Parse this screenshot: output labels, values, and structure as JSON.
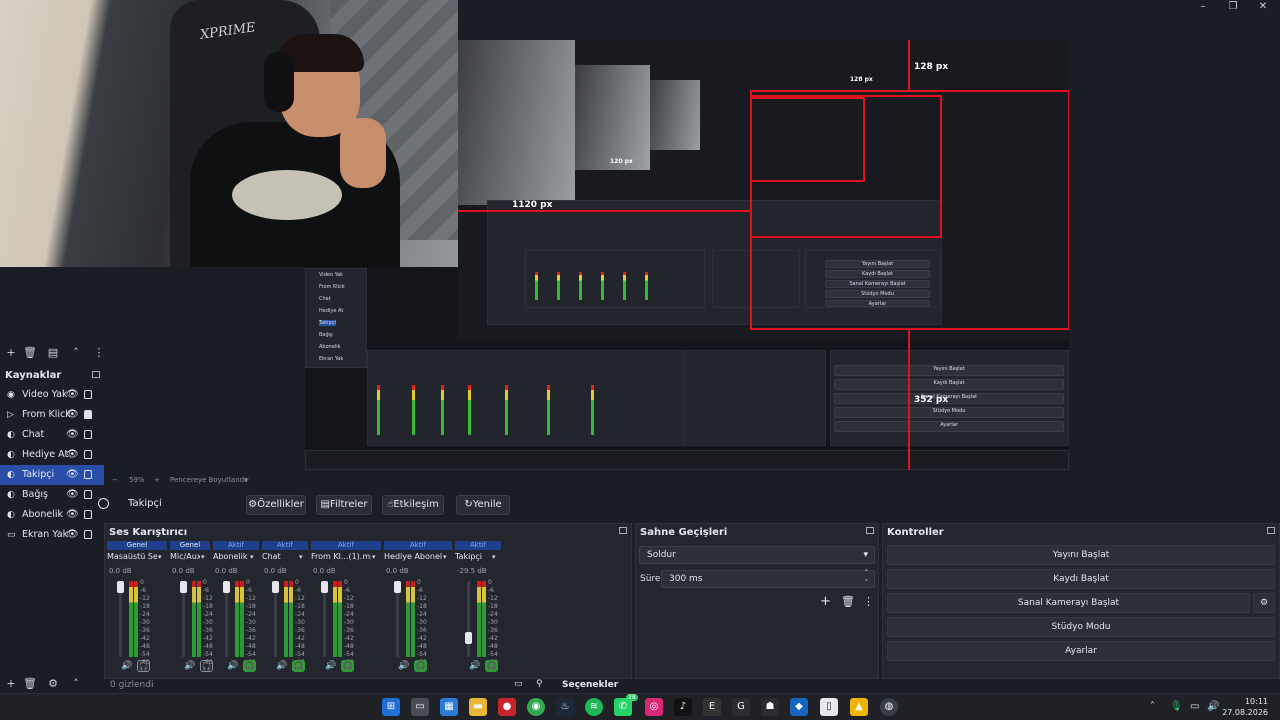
{
  "window": {
    "minimize": "–",
    "maximize": "❐",
    "close": "✕"
  },
  "webcam": {
    "chair_brand": "XPRIME"
  },
  "preview": {
    "labels": {
      "top": "128 px",
      "top_small": "128 px",
      "left": "1120 px",
      "left_small": "120 px",
      "right": "352 px"
    },
    "mini_sources": [
      "Video Yak",
      "From Klick",
      "Chat",
      "Hediye At",
      "Takipçi",
      "Bağış",
      "Abonelik",
      "Ekran Yak"
    ],
    "mini_controls": [
      "Yayını Başlat",
      "Kaydı Başlat",
      "Sanal Kamerayı Başlat",
      "Stüdyo Modu",
      "Ayarlar"
    ]
  },
  "sources": {
    "title": "Kaynaklar",
    "items": [
      {
        "label": "Video Yak",
        "icon": "play-icon",
        "glyph": "◉",
        "locked": false
      },
      {
        "label": "From Klick",
        "icon": "play-icon",
        "glyph": "▷",
        "locked": true
      },
      {
        "label": "Chat",
        "icon": "globe-icon",
        "glyph": "◐",
        "locked": false
      },
      {
        "label": "Hediye At",
        "icon": "globe-icon",
        "glyph": "◐",
        "locked": false
      },
      {
        "label": "Takipçi",
        "icon": "globe-icon",
        "glyph": "◐",
        "locked": false,
        "selected": true
      },
      {
        "label": "Bağış",
        "icon": "globe-icon",
        "glyph": "◐",
        "locked": false
      },
      {
        "label": "Abonelik",
        "icon": "globe-icon",
        "glyph": "◐",
        "locked": false
      },
      {
        "label": "Ekran Yak",
        "icon": "monitor-icon",
        "glyph": "▭",
        "locked": false
      }
    ]
  },
  "status": {
    "zoom": "59%",
    "resize_label": "Pencereye Boyutlandır"
  },
  "source_toolbar": {
    "current_source": "Takipçi",
    "properties": "Özellikler",
    "filters": "Filtreler",
    "interact": "Etkileşim",
    "refresh": "Yenile"
  },
  "mixer": {
    "title": "Ses Karıştırıcı",
    "channels": [
      {
        "tag": "Genel",
        "name": "Masaüstü Ses",
        "db": "0.0 dB",
        "level": 1.0
      },
      {
        "tag": "Genel",
        "name": "Mic/Aux",
        "db": "0.0 dB",
        "level": 1.0
      },
      {
        "tag": "Aktif",
        "name": "Abonelik",
        "db": "0.0 dB",
        "level": 1.0
      },
      {
        "tag": "Aktif",
        "name": "Chat",
        "db": "0.0 dB",
        "level": 1.0
      },
      {
        "tag": "Aktif",
        "name": "From Kl...(1).mp4",
        "db": "0.0 dB",
        "level": 1.0
      },
      {
        "tag": "Aktif",
        "name": "Hediye Abonelik",
        "db": "0.0 dB",
        "level": 1.0
      },
      {
        "tag": "Aktif",
        "name": "Takipçi",
        "db": "-29.5 dB",
        "level": 0.2
      }
    ],
    "scale": [
      "0",
      "-6",
      "-12",
      "-18",
      "-24",
      "-30",
      "-36",
      "-42",
      "-48",
      "-54",
      "-60"
    ],
    "footer_left": "0 gizlendi",
    "footer_right": "Seçenekler"
  },
  "transitions": {
    "title": "Sahne Geçişleri",
    "selected": "Soldur",
    "duration_label": "Süre",
    "duration_value": "300 ms"
  },
  "controls": {
    "title": "Kontroller",
    "start_stream": "Yayını Başlat",
    "start_record": "Kaydı Başlat",
    "virtual_cam": "Sanal Kamerayı Başlat",
    "studio_mode": "Stüdyo Modu",
    "settings": "Ayarlar"
  },
  "taskbar": {
    "whatsapp_badge": "28",
    "time": "10:11",
    "date": "27.08.2026"
  },
  "colors": {
    "accent": "#2a4ea8",
    "guide_red": "#e0101e",
    "meter_green": "#2d9a37"
  }
}
